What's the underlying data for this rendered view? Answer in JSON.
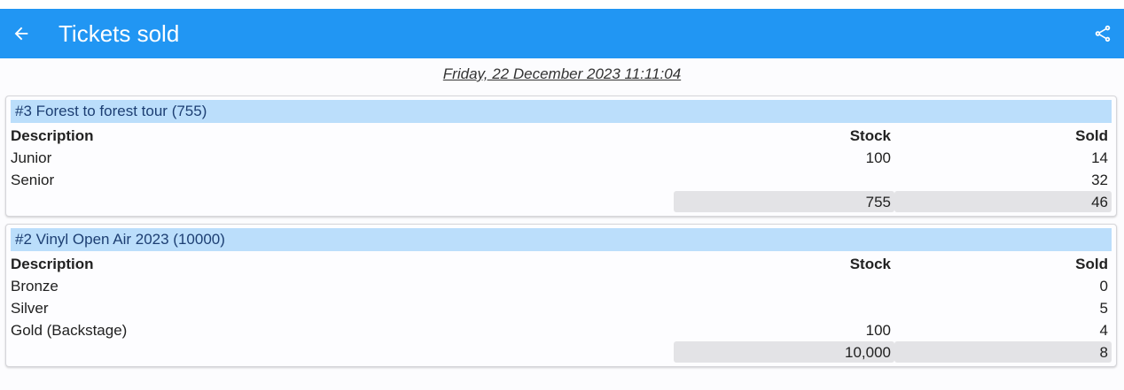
{
  "appbar": {
    "title": "Tickets sold",
    "back_icon": "arrow-back-icon",
    "share_icon": "share-icon",
    "color": "#2196f3"
  },
  "date": "Friday, 22 December 2023 11:11:04",
  "columns": {
    "description": "Description",
    "stock": "Stock",
    "sold": "Sold"
  },
  "events": [
    {
      "title": "#3 Forest to forest tour (755)",
      "rows": [
        {
          "description": "Junior",
          "stock": "100",
          "sold": "14"
        },
        {
          "description": "Senior",
          "stock": "",
          "sold": "32"
        }
      ],
      "total": {
        "stock": "755",
        "sold": "46"
      }
    },
    {
      "title": "#2 Vinyl Open Air 2023 (10000)",
      "rows": [
        {
          "description": "Bronze",
          "stock": "",
          "sold": "0"
        },
        {
          "description": "Silver",
          "stock": "",
          "sold": "5"
        },
        {
          "description": "Gold (Backstage)",
          "stock": "100",
          "sold": "4"
        }
      ],
      "total": {
        "stock": "10,000",
        "sold": "8"
      }
    }
  ]
}
